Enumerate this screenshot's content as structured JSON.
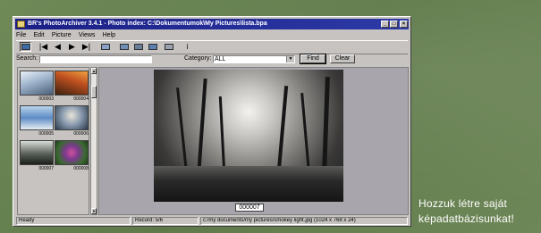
{
  "window": {
    "title": "BR's PhotoArchiver 3.4.1 - Photo index: C:\\Dokumentumok\\My Pictures\\lista.bpa",
    "controls": {
      "minimize": "_",
      "maximize": "□",
      "close": "×"
    }
  },
  "menu": [
    "File",
    "Edit",
    "Picture",
    "Views",
    "Help"
  ],
  "toolbar": {
    "icons": [
      "slideshow-icon",
      "first-icon",
      "previous-icon",
      "next-icon",
      "last-icon",
      "edit-icon",
      "new-icon",
      "save-icon",
      "find-icon",
      "print-icon",
      "info-icon"
    ],
    "labels": {
      "new": "New",
      "save": "Save"
    }
  },
  "search": {
    "label": "Search:",
    "value": ""
  },
  "category": {
    "label": "Category:",
    "value": "ALL"
  },
  "buttons": {
    "find": "Find",
    "clear": "Clear"
  },
  "thumbnails": [
    {
      "caption": "000003"
    },
    {
      "caption": "000004"
    },
    {
      "caption": "000005"
    },
    {
      "caption": "000006"
    },
    {
      "caption": "000007"
    },
    {
      "caption": "000008"
    }
  ],
  "viewer": {
    "photo_caption": "000007"
  },
  "status": {
    "state": "Ready",
    "record": "Record: 5/6",
    "path": "c:/my documents/my pictures/smokey light.jpg  (1024 x 768 x 24)"
  },
  "caption_lines": [
    "Hozzuk létre saját",
    "képadatbázisunkat!"
  ],
  "colors": {
    "titlebar": "#1a1f86",
    "window_face": "#c6c3c0",
    "viewer_bg": "#a9a5ad",
    "background": "#6d8456"
  }
}
